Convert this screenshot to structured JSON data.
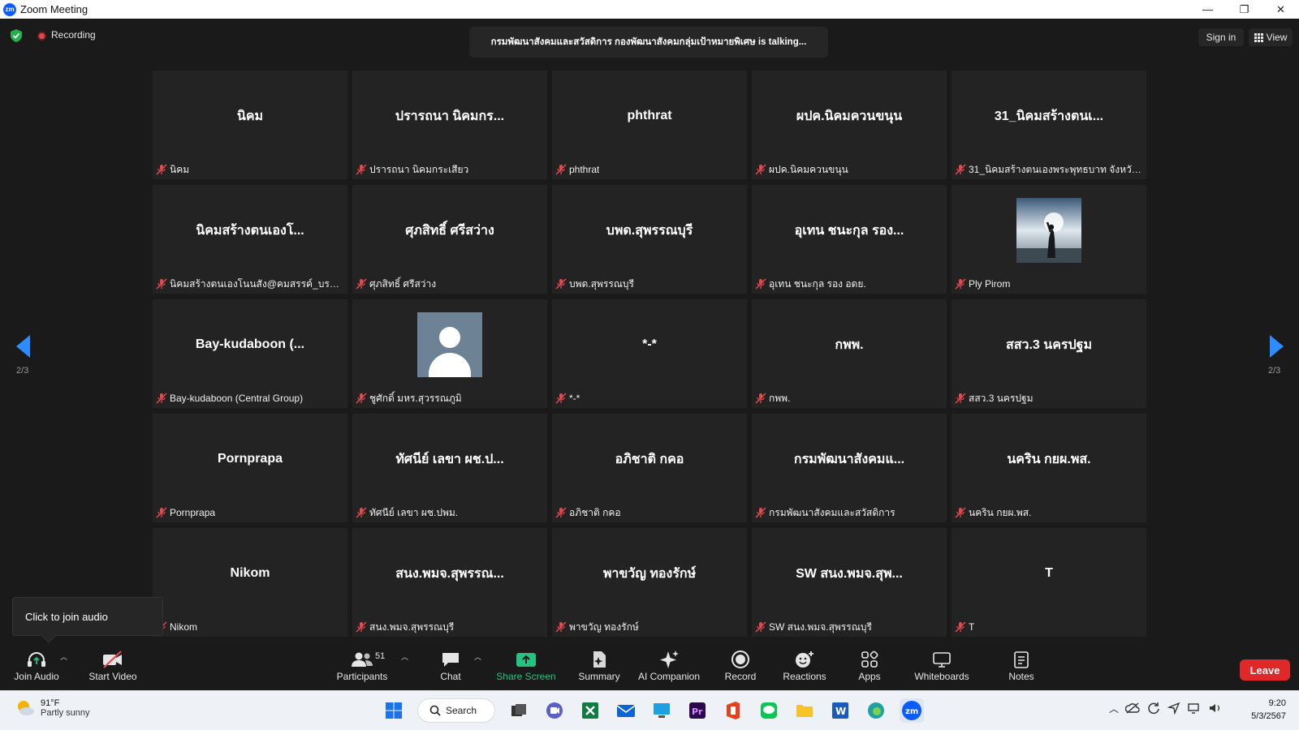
{
  "window": {
    "title": "Zoom Meeting",
    "logo_text": "zm",
    "controls": [
      "—",
      "❐",
      "✕"
    ]
  },
  "topbar": {
    "recording_label": "Recording",
    "talking_banner": "กรมพัฒนาสังคมและสวัสดิการ กองพัฒนาสังคมกลุ่มเป้าหมายพิเศษ  is  talking...",
    "sign_in": "Sign in",
    "view": "View"
  },
  "pagination": {
    "left": "2/3",
    "right": "2/3"
  },
  "tiles": [
    {
      "display": "นิคม",
      "name": "นิคม"
    },
    {
      "display": "ปรารถนา นิคมกร...",
      "name": "ปรารถนา นิคมกระเสียว"
    },
    {
      "display": "phthrat",
      "name": "phthrat"
    },
    {
      "display": "ผปค.นิคมควนขนุน",
      "name": "ผปค.นิคมควนขนุน"
    },
    {
      "display": "31_นิคมสร้างตนเ...",
      "name": "31_นิคมสร้างตนเองพระพุทธบาท จังหวัดส..."
    },
    {
      "display": "นิคมสร้างตนเองโ...",
      "name": "นิคมสร้างตนเองโนนสัง@คมสรรค์_บรรเรือง..."
    },
    {
      "display": "ศุภสิทธิ์ ศรีสว่าง",
      "name": "ศุภสิทธิ์ ศรีสว่าง"
    },
    {
      "display": "บพด.สุพรรณบุรี",
      "name": "บพด.สุพรรณบุรี"
    },
    {
      "display": "อุเทน ชนะกุล รอง...",
      "name": "อุเทน ชนะกุล รอง อดย."
    },
    {
      "display": "",
      "name": "Ply Pirom",
      "media": "photo"
    },
    {
      "display": "Bay-kudaboon  (...",
      "name": "Bay-kudaboon (Central Group)"
    },
    {
      "display": "",
      "name": "ชูศักดิ์ มหร.สุวรรณภูมิ",
      "media": "avatar"
    },
    {
      "display": "*-*",
      "name": "*-*"
    },
    {
      "display": "กพพ.",
      "name": "กพพ."
    },
    {
      "display": "สสว.3 นครปฐม",
      "name": "สสว.3 นครปฐม"
    },
    {
      "display": "Pornprapa",
      "name": "Pornprapa"
    },
    {
      "display": "ทัศนีย์ เลขา ผช.ป...",
      "name": "ทัศนีย์ เลขา ผช.ปพม."
    },
    {
      "display": "อภิชาติ กคอ",
      "name": "อภิชาติ กคอ"
    },
    {
      "display": "กรมพัฒนาสังคมแ...",
      "name": "กรมพัฒนาสังคมและสวัสดิการ"
    },
    {
      "display": "นคริน กยผ.พส.",
      "name": "นคริน กยผ.พส."
    },
    {
      "display": "Nikom",
      "name": "Nikom"
    },
    {
      "display": "สนง.พมจ.สุพรรณ...",
      "name": "สนง.พมจ.สุพรรณบุรี"
    },
    {
      "display": "พาขวัญ  ทองรักษ์",
      "name": "พาขวัญ  ทองรักษ์"
    },
    {
      "display": "SW สนง.พมจ.สุพ...",
      "name": "SW สนง.พมจ.สุพรรณบุรี"
    },
    {
      "display": "T",
      "name": "T"
    }
  ],
  "tooltip": {
    "text": "Click to join audio"
  },
  "toolbar": {
    "join_audio": "Join Audio",
    "start_video": "Start Video",
    "participants": "Participants",
    "participants_count": "51",
    "chat": "Chat",
    "share_screen": "Share Screen",
    "summary": "Summary",
    "ai_companion": "AI Companion",
    "record": "Record",
    "reactions": "Reactions",
    "apps": "Apps",
    "whiteboards": "Whiteboards",
    "notes": "Notes",
    "leave": "Leave"
  },
  "taskbar": {
    "weather_temp": "91°F",
    "weather_desc": "Partly sunny",
    "search": "Search",
    "time": "9:20",
    "date": "5/3/2567"
  },
  "colors": {
    "accent": "#2d8cff",
    "leave": "#e02828",
    "share": "#26c281",
    "muted_mic": "#e5484d"
  }
}
